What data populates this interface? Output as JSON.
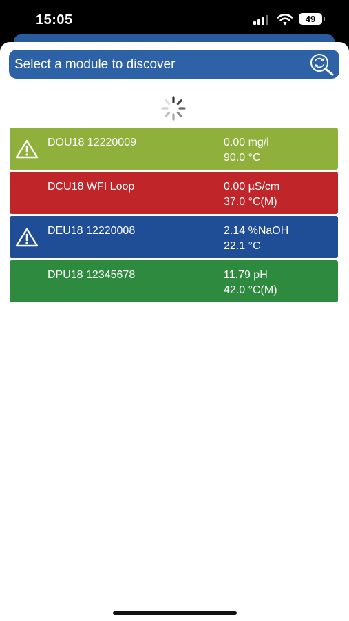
{
  "status_bar": {
    "time": "15:05",
    "battery": "49"
  },
  "search": {
    "label": "Select a module to discover",
    "icon": "search-refresh-icon",
    "color": "#2d63a6"
  },
  "modules": [
    {
      "name": "DOU18 12220009",
      "value1": "0.00 mg/l",
      "value2": "90.0 °C",
      "color": "#8fb03a",
      "warning": true
    },
    {
      "name": "DCU18 WFI Loop",
      "value1": "0.00 µS/cm",
      "value2": "37.0 °C(M)",
      "color": "#c0252a",
      "warning": false
    },
    {
      "name": "DEU18 12220008",
      "value1": "2.14 %NaOH",
      "value2": "22.1 °C",
      "color": "#1f4e96",
      "warning": true
    },
    {
      "name": "DPU18 12345678",
      "value1": "11.79 pH",
      "value2": "42.0 °C(M)",
      "color": "#2e8a3e",
      "warning": false
    }
  ]
}
